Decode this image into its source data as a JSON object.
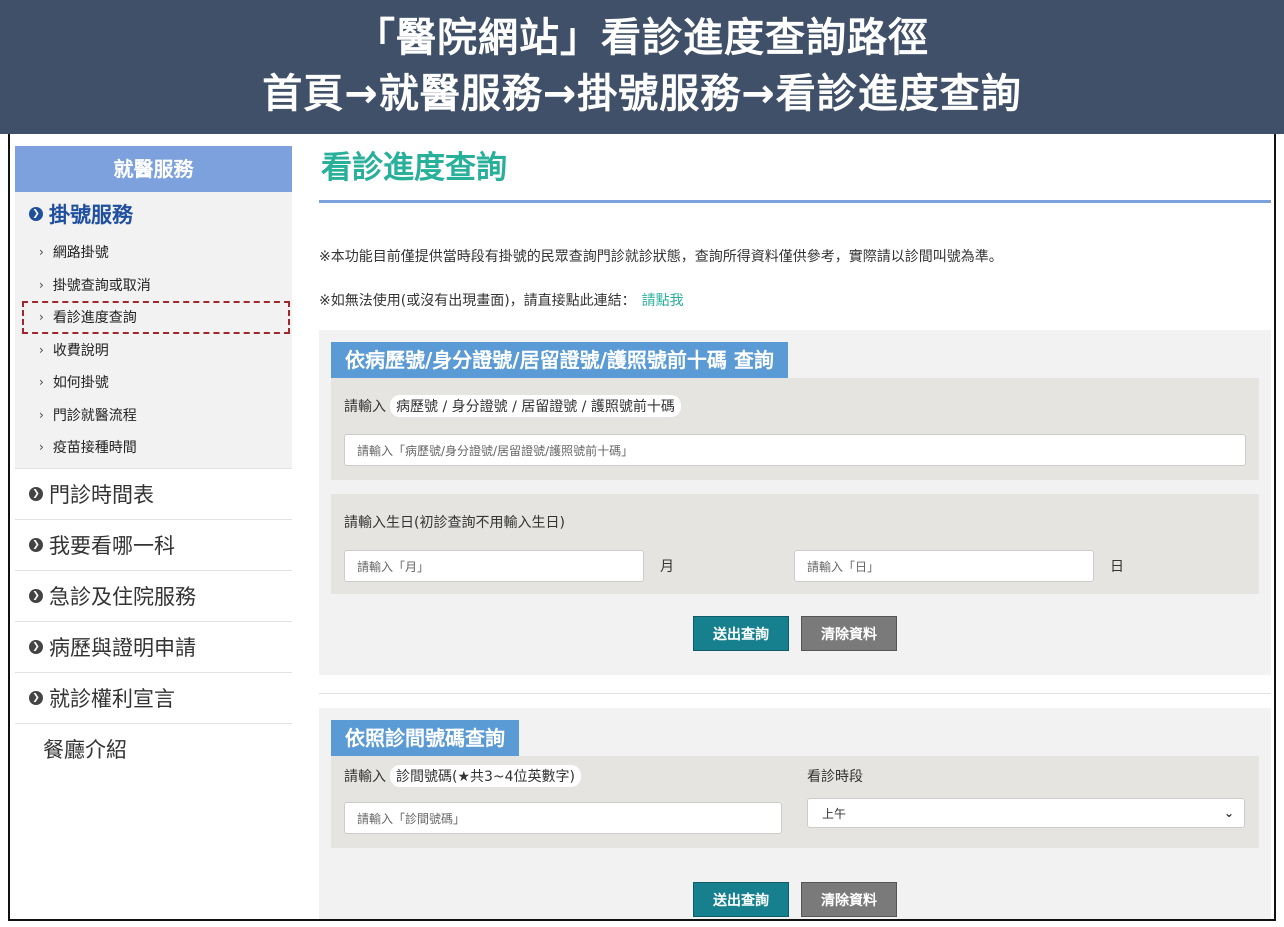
{
  "banner": {
    "line1": "「醫院網站」看診進度查詢路徑",
    "line2": "首頁→就醫服務→掛號服務→看診進度查詢"
  },
  "sidebar": {
    "header": "就醫服務",
    "group": {
      "label": "掛號服務",
      "items": [
        {
          "label": "網路掛號"
        },
        {
          "label": "掛號查詢或取消"
        },
        {
          "label": "看診進度查詢"
        },
        {
          "label": "收費說明"
        },
        {
          "label": "如何掛號"
        },
        {
          "label": "門診就醫流程"
        },
        {
          "label": "疫苗接種時間"
        }
      ]
    },
    "links": [
      {
        "label": "門診時間表"
      },
      {
        "label": "我要看哪一科"
      },
      {
        "label": "急診及住院服務"
      },
      {
        "label": "病歷與證明申請"
      },
      {
        "label": "就診權利宣言"
      }
    ],
    "extra": "餐廳介紹"
  },
  "main": {
    "title": "看診進度查詢",
    "note1": "※本功能目前僅提供當時段有掛號的民眾查詢門診就診狀態，查詢所得資料僅供參考，實際請以診間叫號為準。",
    "note2": "※如無法使用(或沒有出現畫面)，請直接點此連結：",
    "note2_link": "請點我",
    "form1": {
      "title": "依病歷號/身分證號/居留證號/護照號前十碼 查詢",
      "id_label_prefix": "請輸入",
      "id_label_pill": "病歷號 / 身分證號 / 居留證號 / 護照號前十碼",
      "id_placeholder": "請輸入「病歷號/身分證號/居留證號/護照號前十碼」",
      "birth_label": "請輸入生日(初診查詢不用輸入生日)",
      "month_placeholder": "請輸入「月」",
      "month_unit": "月",
      "day_placeholder": "請輸入「日」",
      "day_unit": "日",
      "submit": "送出查詢",
      "clear": "清除資料"
    },
    "form2": {
      "title": "依照診間號碼查詢",
      "room_label_prefix": "請輸入",
      "room_label_pill": "診間號碼(★共3~4位英數字)",
      "room_placeholder": "請輸入「診間號碼」",
      "session_label": "看診時段",
      "session_value": "上午",
      "submit": "送出查詢",
      "clear": "清除資料"
    }
  }
}
